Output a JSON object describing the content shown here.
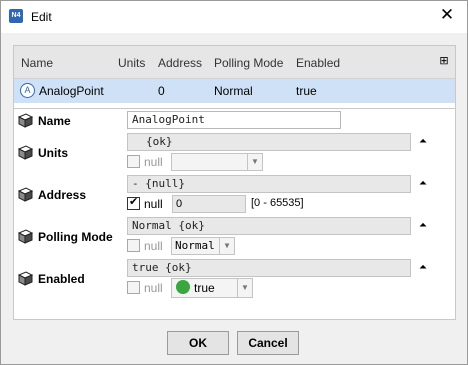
{
  "window": {
    "title": "Edit",
    "app_icon": "N4"
  },
  "table": {
    "headers": [
      "Name",
      "Units",
      "Address",
      "Polling Mode",
      "Enabled"
    ],
    "row": {
      "name": "AnalogPoint",
      "units": "",
      "address": "0",
      "polling_mode": "Normal",
      "enabled": "true"
    }
  },
  "properties": {
    "name": {
      "label": "Name",
      "value": "AnalogPoint"
    },
    "units": {
      "label": "Units",
      "value": "{ok}",
      "null_label": "null",
      "select_value": ""
    },
    "address": {
      "label": "Address",
      "value": "- {null}",
      "null_label": "null",
      "number": "0",
      "range": "[0 - 65535]"
    },
    "polling_mode": {
      "label": "Polling Mode",
      "value": "Normal {ok}",
      "null_label": "null",
      "select_value": "Normal"
    },
    "enabled": {
      "label": "Enabled",
      "value": "true {ok}",
      "null_label": "null",
      "select_value": "true"
    }
  },
  "buttons": {
    "ok": "OK",
    "cancel": "Cancel"
  },
  "colors": {
    "selection": "#cfe1f7",
    "accent": "#2f67b7",
    "enabled_true": "#3aa640"
  }
}
